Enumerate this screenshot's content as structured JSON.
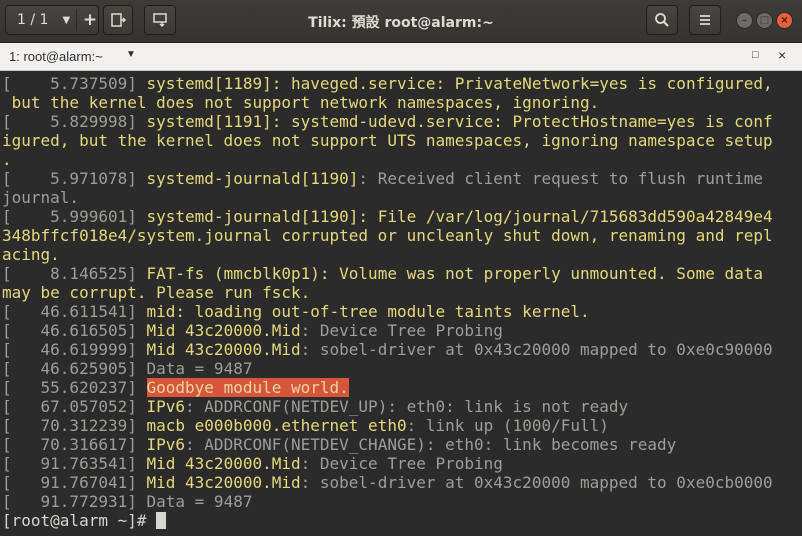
{
  "header": {
    "session_label": "1 / 1",
    "title": "Tilix: 預設 root@alarm:~"
  },
  "terminal_tab": {
    "title": "1: root@alarm:~"
  },
  "icons": [
    "chevron-down-icon",
    "add-icon",
    "split-right-icon",
    "split-down-icon",
    "search-icon",
    "menu-icon",
    "minimize-icon",
    "maximize-icon",
    "close-icon"
  ],
  "colors": {
    "terminal_bg": "#2b2b2b",
    "timestamp": "#9f9d95",
    "yellow": "#e6d87a",
    "highlight": "#d7553a"
  },
  "terminal": {
    "lines": [
      [
        {
          "t": "[    5.737509] ",
          "c": "g"
        },
        {
          "t": "systemd[1189]: haveged.service: PrivateNetwork=yes is configured,",
          "c": "y"
        }
      ],
      [
        {
          "t": " but the kernel does not support network namespaces, ignoring.",
          "c": "y"
        }
      ],
      [
        {
          "t": "[    5.829998] ",
          "c": "g"
        },
        {
          "t": "systemd[1191]: systemd-udevd.service: ProtectHostname=yes is conf",
          "c": "y"
        }
      ],
      [
        {
          "t": "igured, but the kernel does not support UTS namespaces, ignoring namespace setup",
          "c": "y"
        }
      ],
      [
        {
          "t": ".",
          "c": "y"
        }
      ],
      [
        {
          "t": "[    5.971078] ",
          "c": "g"
        },
        {
          "t": "systemd-journald[1190]",
          "c": "y"
        },
        {
          "t": ": Received client request to flush runtime",
          "c": "g"
        }
      ],
      [
        {
          "t": "journal.",
          "c": "g"
        }
      ],
      [
        {
          "t": "[    5.999601] ",
          "c": "g"
        },
        {
          "t": "systemd-journald[1190]: File /var/log/journal/715683dd590a42849e4",
          "c": "y"
        }
      ],
      [
        {
          "t": "348bffcf018e4/system.journal corrupted or uncleanly shut down, renaming and repl",
          "c": "y"
        }
      ],
      [
        {
          "t": "acing.",
          "c": "y"
        }
      ],
      [
        {
          "t": "[    8.146525] ",
          "c": "g"
        },
        {
          "t": "FAT-fs (mmcblk0p1): Volume was not properly unmounted. Some data",
          "c": "y"
        }
      ],
      [
        {
          "t": "may be corrupt. Please run fsck.",
          "c": "y"
        }
      ],
      [
        {
          "t": "[   46.611541] ",
          "c": "g"
        },
        {
          "t": "mid: loading out-of-tree module taints kernel.",
          "c": "y"
        }
      ],
      [
        {
          "t": "[   46.616505] ",
          "c": "g"
        },
        {
          "t": "Mid 43c20000.Mid",
          "c": "y"
        },
        {
          "t": ": Device Tree Probing",
          "c": "g"
        }
      ],
      [
        {
          "t": "[   46.619999] ",
          "c": "g"
        },
        {
          "t": "Mid 43c20000.Mid",
          "c": "y"
        },
        {
          "t": ": sobel-driver at 0x43c20000 mapped to 0xe0c90000",
          "c": "g"
        }
      ],
      [
        {
          "t": "[   46.625905] ",
          "c": "g"
        },
        {
          "t": "Data = 9487",
          "c": "g"
        }
      ],
      [
        {
          "t": "[   55.620237] ",
          "c": "g"
        },
        {
          "t": "Goodbye module world.",
          "c": "hl"
        }
      ],
      [
        {
          "t": "[   67.057052] ",
          "c": "g"
        },
        {
          "t": "IPv6",
          "c": "y"
        },
        {
          "t": ": ADDRCONF(NETDEV_UP): eth0: link is not ready",
          "c": "g"
        }
      ],
      [
        {
          "t": "[   70.312239] ",
          "c": "g"
        },
        {
          "t": "macb e000b000.ethernet eth0",
          "c": "y"
        },
        {
          "t": ": link up (1000/Full)",
          "c": "g"
        }
      ],
      [
        {
          "t": "[   70.316617] ",
          "c": "g"
        },
        {
          "t": "IPv6",
          "c": "y"
        },
        {
          "t": ": ADDRCONF(NETDEV_CHANGE): eth0: link becomes ready",
          "c": "g"
        }
      ],
      [
        {
          "t": "[   91.763541] ",
          "c": "g"
        },
        {
          "t": "Mid 43c20000.Mid",
          "c": "y"
        },
        {
          "t": ": Device Tree Probing",
          "c": "g"
        }
      ],
      [
        {
          "t": "[   91.767041] ",
          "c": "g"
        },
        {
          "t": "Mid 43c20000.Mid",
          "c": "y"
        },
        {
          "t": ": sobel-driver at 0x43c20000 mapped to 0xe0cb0000",
          "c": "g"
        }
      ],
      [
        {
          "t": "[   91.772931] ",
          "c": "g"
        },
        {
          "t": "Data = 9487",
          "c": "g"
        }
      ]
    ],
    "prompt": "[root@alarm ~]# "
  }
}
